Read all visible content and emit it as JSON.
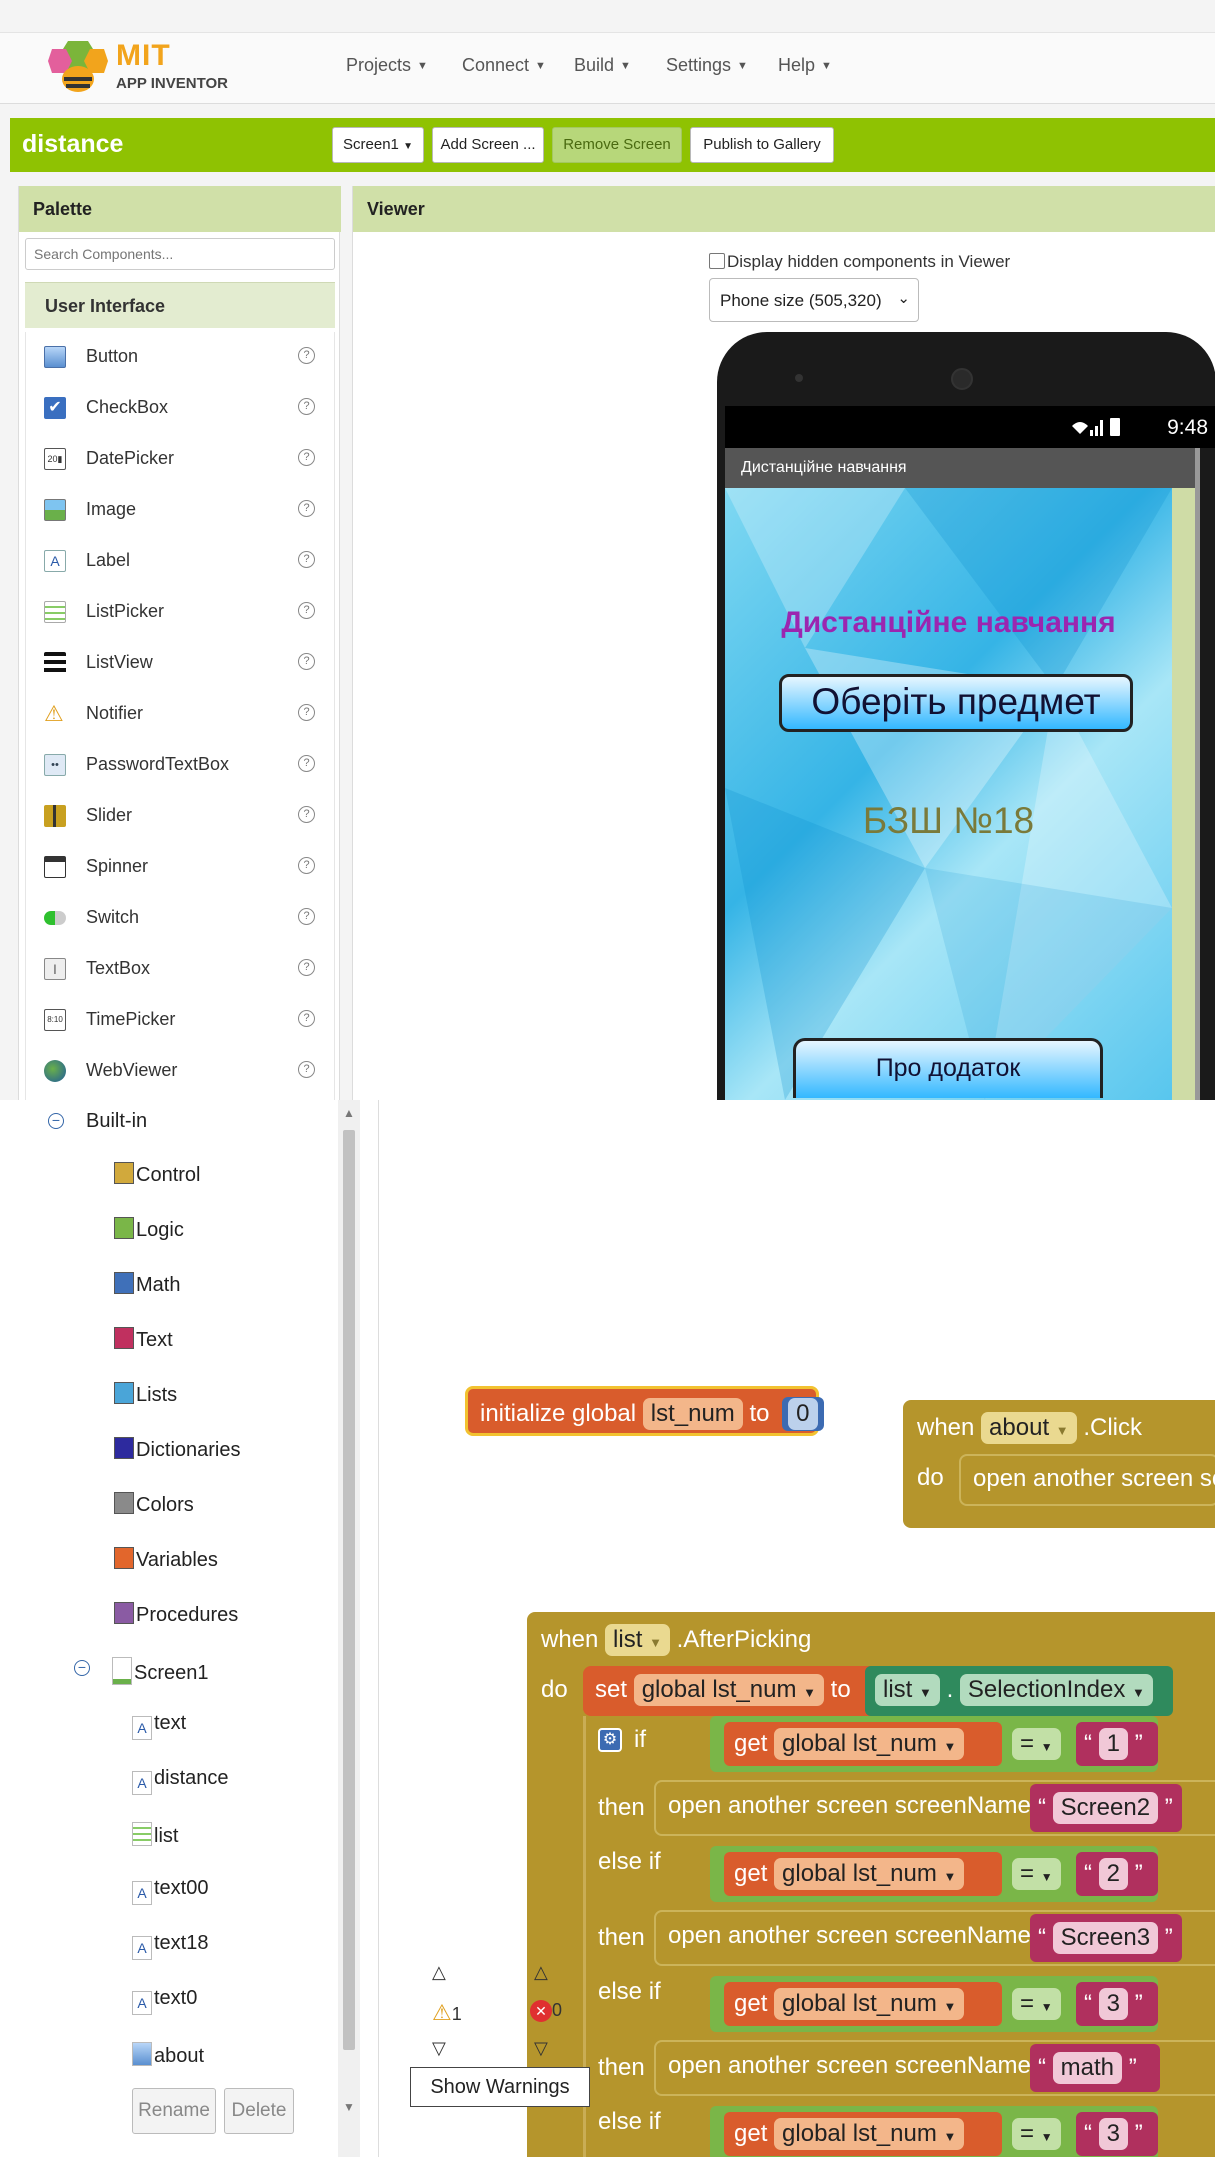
{
  "header": {
    "logo_mit": "MIT",
    "logo_sub": "APP INVENTOR",
    "menus": [
      "Projects",
      "Connect",
      "Build",
      "Settings",
      "Help"
    ]
  },
  "project": {
    "name": "distance",
    "screen_button": "Screen1",
    "add_screen": "Add Screen ...",
    "remove_screen": "Remove Screen",
    "publish": "Publish to Gallery"
  },
  "palette": {
    "title": "Palette",
    "search_placeholder": "Search Components...",
    "category": "User Interface",
    "items": [
      {
        "label": "Button",
        "icon": "button-icon"
      },
      {
        "label": "CheckBox",
        "icon": "checkbox-icon"
      },
      {
        "label": "DatePicker",
        "icon": "datepicker-icon"
      },
      {
        "label": "Image",
        "icon": "image-icon"
      },
      {
        "label": "Label",
        "icon": "label-icon"
      },
      {
        "label": "ListPicker",
        "icon": "listpicker-icon"
      },
      {
        "label": "ListView",
        "icon": "listview-icon"
      },
      {
        "label": "Notifier",
        "icon": "notifier-icon"
      },
      {
        "label": "PasswordTextBox",
        "icon": "password-icon"
      },
      {
        "label": "Slider",
        "icon": "slider-icon"
      },
      {
        "label": "Spinner",
        "icon": "spinner-icon"
      },
      {
        "label": "Switch",
        "icon": "switch-icon"
      },
      {
        "label": "TextBox",
        "icon": "textbox-icon"
      },
      {
        "label": "TimePicker",
        "icon": "timepicker-icon"
      },
      {
        "label": "WebViewer",
        "icon": "webviewer-icon"
      }
    ],
    "help_glyph": "?"
  },
  "viewer": {
    "title": "Viewer",
    "hidden_label": "Display hidden components in Viewer",
    "size_select": "Phone size (505,320)",
    "phone": {
      "time": "9:48",
      "app_title": "Дистанційне навчання",
      "screen_title": "Дистанційне навчання",
      "choose_button": "Оберіть предмет",
      "school": "БЗШ №18",
      "about_button": "Про додаток"
    }
  },
  "blocks_tree": {
    "builtin_label": "Built-in",
    "builtin": [
      {
        "label": "Control",
        "color": "#d1a93c"
      },
      {
        "label": "Logic",
        "color": "#7ab648"
      },
      {
        "label": "Math",
        "color": "#3f70b9"
      },
      {
        "label": "Text",
        "color": "#c0305f"
      },
      {
        "label": "Lists",
        "color": "#4aa5d8"
      },
      {
        "label": "Dictionaries",
        "color": "#2d2a9e"
      },
      {
        "label": "Colors",
        "color": "#8a8a8a"
      },
      {
        "label": "Variables",
        "color": "#e2662c"
      },
      {
        "label": "Procedures",
        "color": "#8a5ba3"
      }
    ],
    "screen_label": "Screen1",
    "components": [
      {
        "label": "text",
        "icon": "label-icon"
      },
      {
        "label": "distance",
        "icon": "label-icon"
      },
      {
        "label": "list",
        "icon": "listpicker-icon"
      },
      {
        "label": "text00",
        "icon": "label-icon"
      },
      {
        "label": "text18",
        "icon": "label-icon"
      },
      {
        "label": "text0",
        "icon": "label-icon"
      },
      {
        "label": "about",
        "icon": "button-icon"
      }
    ],
    "rename": "Rename",
    "delete": "Delete"
  },
  "workspace": {
    "init": {
      "kw": "initialize global",
      "var": "lst_num",
      "to": "to",
      "num": "0"
    },
    "about_click": {
      "when": "when",
      "comp": "about",
      "event": ".Click",
      "do": "do",
      "action": "open another screen  sc"
    },
    "after_picking": {
      "when": "when",
      "comp": "list",
      "event": ".AfterPicking",
      "do": "do",
      "set": "set",
      "var": "global lst_num",
      "to": "to",
      "list": "list",
      "dot": ".",
      "prop": "SelectionIndex",
      "if": "if",
      "then": "then",
      "else_if": "else if",
      "get": "get",
      "get_var": "global lst_num",
      "eq": "=",
      "open": "open another screen  screenName",
      "rows": [
        {
          "val": "1",
          "screen": "Screen2"
        },
        {
          "val": "2",
          "screen": "Screen3"
        },
        {
          "val": "3",
          "screen": "math"
        },
        {
          "val": "3",
          "screen": ""
        }
      ]
    },
    "warnings_count": "1",
    "errors_count": "0",
    "show_warnings": "Show Warnings"
  }
}
